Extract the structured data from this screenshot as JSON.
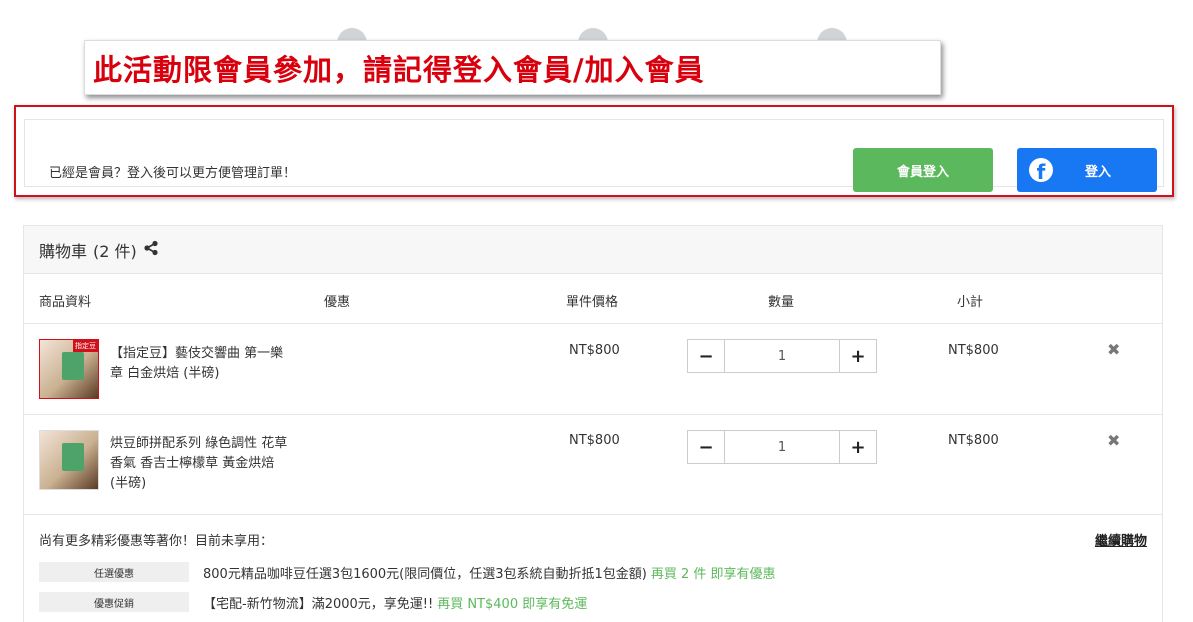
{
  "notice": {
    "text": "此活動限會員參加，請記得登入會員/加入會員"
  },
  "login": {
    "prompt": "已經是會員？登入後可以更方便管理訂單！",
    "member_login_label": "會員登入",
    "fb_login_label": "登入"
  },
  "cart": {
    "title": "購物車",
    "count": "(2 件)",
    "columns": {
      "product": "商品資料",
      "discount": "優惠",
      "unit_price": "單件價格",
      "quantity": "數量",
      "subtotal": "小計"
    },
    "items": [
      {
        "tag": "指定豆",
        "name": "【指定豆】藝伎交響曲 第一樂章 白金烘焙 (半磅)",
        "price": "NT$800",
        "qty": "1",
        "subtotal": "NT$800"
      },
      {
        "name": "烘豆師拼配系列 綠色調性 花草香氣 香吉士檸檬草 黃金烘焙 (半磅)",
        "price": "NT$800",
        "qty": "1",
        "subtotal": "NT$800"
      }
    ],
    "qty_minus": "−",
    "qty_plus": "+",
    "remove_icon": "✖"
  },
  "promo": {
    "note": "尚有更多精彩優惠等著你！目前未享用：",
    "continue_label": "繼續購物",
    "lines": [
      {
        "tag": "任選優惠",
        "desc": "800元精品咖啡豆任選3包1600元(限同價位，任選3包系統自動折抵1包金額)",
        "hint": "再買 2 件 即享有優惠"
      },
      {
        "tag": "優惠促銷",
        "desc": "【宅配-新竹物流】滿2000元，享免運!!",
        "hint": "再買 NT$400 即享有免運"
      }
    ]
  },
  "colors": {
    "accent_red": "#d9000d",
    "member_green": "#5cb85c",
    "facebook_blue": "#1877f2"
  }
}
